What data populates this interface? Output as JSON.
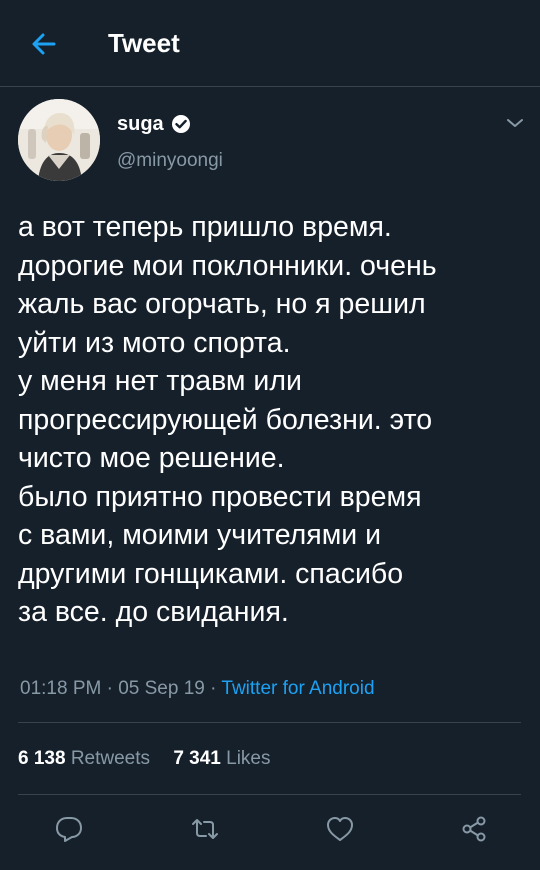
{
  "header": {
    "title": "Tweet",
    "back_icon": "arrow-left-icon"
  },
  "author": {
    "display_name": "suga",
    "handle": "@minyoongi",
    "verified": true,
    "verified_icon": "verified-badge-icon"
  },
  "tweet": {
    "text": "а вот теперь пришло время.\nдорогие мои поклонники. очень\nжаль вас огорчать, но я решил\nуйти из мото спорта.\nу меня нет травм или\nпрогрессирующей болезни. это\nчисто мое решение.\nбыло приятно провести время\nс вами, моими учителями и\nдругими гонщиками. спасибо\nза все. до свидания.",
    "time": "01:18 PM",
    "date": "05 Sep 19",
    "separator": "·",
    "source": "Twitter for Android"
  },
  "stats": {
    "retweets_count": "6 138",
    "retweets_label": "Retweets",
    "likes_count": "7 341",
    "likes_label": "Likes"
  },
  "actions": [
    "reply-icon",
    "retweet-icon",
    "like-icon",
    "share-icon"
  ],
  "colors": {
    "background": "#15202b",
    "accent": "#1da1f2",
    "secondary_text": "#8899a6",
    "divider": "#38444d"
  }
}
